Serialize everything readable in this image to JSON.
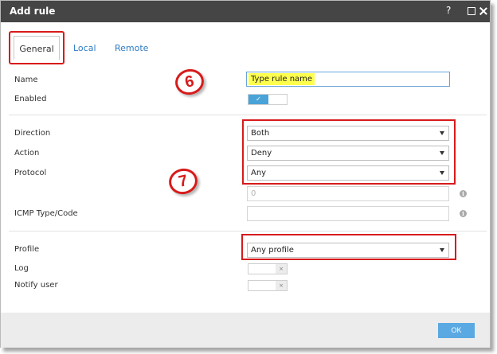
{
  "window": {
    "title": "Add rule",
    "help_glyph": "?"
  },
  "tabs": [
    {
      "label": "General",
      "active": true
    },
    {
      "label": "Local",
      "active": false
    },
    {
      "label": "Remote",
      "active": false
    }
  ],
  "fields": {
    "name_label": "Name",
    "name_value": "Type rule name",
    "enabled_label": "Enabled",
    "enabled_toggle": {
      "state": true,
      "glyph": "✓"
    },
    "direction_label": "Direction",
    "direction_value": "Both",
    "action_label": "Action",
    "action_value": "Deny",
    "protocol_label": "Protocol",
    "protocol_value": "Any",
    "protocol_number_placeholder": "0",
    "icmp_label": "ICMP Type/Code",
    "icmp_value": "",
    "profile_label": "Profile",
    "profile_value": "Any profile",
    "log_label": "Log",
    "log_toggle": {
      "state": false,
      "glyph": "×"
    },
    "notify_label": "Notify user",
    "notify_toggle": {
      "state": false,
      "glyph": "×"
    }
  },
  "annotations": {
    "step_six": "6",
    "step_seven": "7"
  },
  "info_glyph": "i",
  "footer": {
    "ok_label": "OK"
  },
  "colors": {
    "titlebar": "#454545",
    "accent": "#2e7cc4",
    "highlight_red": "#d71b1b",
    "name_highlight_yellow": "#ffff4d",
    "toggle_on": "#4aa3d8",
    "ok_button": "#5aa9e3"
  }
}
